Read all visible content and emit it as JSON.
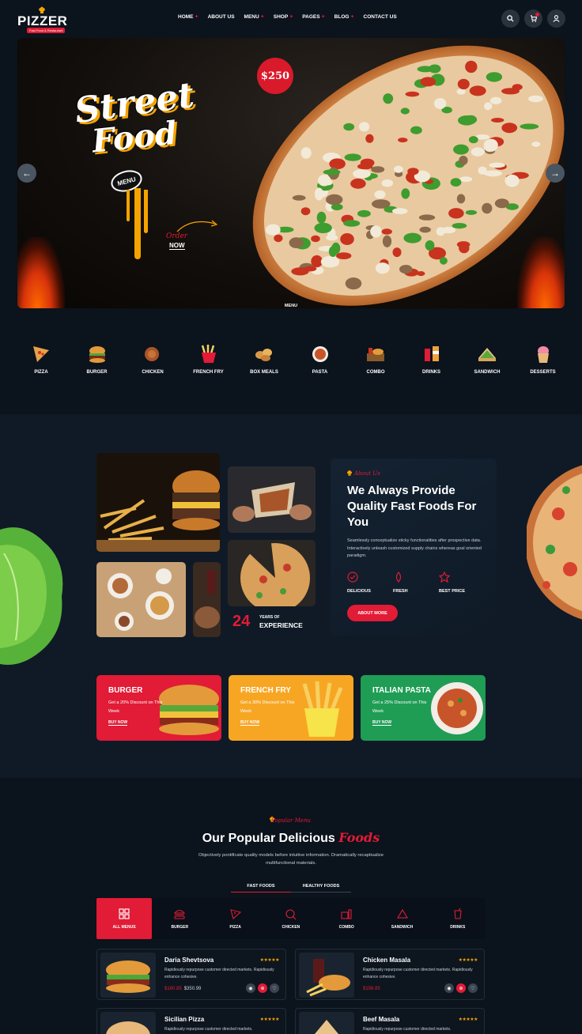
{
  "header": {
    "logo": {
      "text": "PIZZER",
      "tagline": "Fast Food & Restaurant"
    },
    "nav": [
      {
        "label": "HOME",
        "has_dropdown": true
      },
      {
        "label": "ABOUT US",
        "has_dropdown": false
      },
      {
        "label": "MENU",
        "has_dropdown": true
      },
      {
        "label": "SHOP",
        "has_dropdown": true
      },
      {
        "label": "PAGES",
        "has_dropdown": true
      },
      {
        "label": "BLOG",
        "has_dropdown": true
      },
      {
        "label": "CONTACT US",
        "has_dropdown": false
      }
    ],
    "icons": [
      "search-icon",
      "cart-icon",
      "user-icon"
    ]
  },
  "hero": {
    "title_line1": "Street",
    "title_line2": "Food",
    "menu_badge": "MENU",
    "price": "$250",
    "order_script": "Order",
    "order_now": "NOW",
    "caption": "MENU"
  },
  "categories": [
    {
      "label": "PIZZA",
      "icon": "pizza-icon"
    },
    {
      "label": "BURGER",
      "icon": "burger-icon"
    },
    {
      "label": "CHICKEN",
      "icon": "chicken-icon"
    },
    {
      "label": "FRENCH FRY",
      "icon": "fries-icon"
    },
    {
      "label": "BOX MEALS",
      "icon": "box-meal-icon"
    },
    {
      "label": "PASTA",
      "icon": "pasta-icon"
    },
    {
      "label": "COMBO",
      "icon": "combo-icon"
    },
    {
      "label": "DRINKS",
      "icon": "drinks-icon"
    },
    {
      "label": "SANDWICH",
      "icon": "sandwich-icon"
    },
    {
      "label": "DESSERTS",
      "icon": "dessert-icon"
    }
  ],
  "about": {
    "kicker": "About Us",
    "title": "We Always Provide Quality Fast Foods For You",
    "text": "Seamlessly conceptualize sticky functionalities after prospective data. Interactively unleash customized supply chains whereas goal oriented paradigm.",
    "features": [
      {
        "label": "DELICIOUS",
        "icon": "delicious-icon"
      },
      {
        "label": "FRESH",
        "icon": "fresh-icon"
      },
      {
        "label": "BEST PRICE",
        "icon": "best-price-icon"
      }
    ],
    "button": "ABOUT MORE",
    "experience_number": "24",
    "experience_small": "YEARS OF",
    "experience_label": "EXPERIENCE"
  },
  "promos": [
    {
      "title": "BURGER",
      "desc": "Get a 20% Discount on This Week",
      "button": "BUY NOW",
      "color": "#e21b36"
    },
    {
      "title": "FRENCH FRY",
      "desc": "Get a 30% Discount on This Week",
      "button": "BUY NOW",
      "color": "#f7a623"
    },
    {
      "title": "ITALIAN PASTA",
      "desc": "Get a 25% Discount on This Week",
      "button": "BUY NOW",
      "color": "#1f9d55"
    }
  ],
  "menu": {
    "kicker": "Popular Menu",
    "title_main": "Our Popular Delicious ",
    "title_accent": "Foods",
    "subtitle": "Objectively pontificate quality models before intuitive information. Dramatically recaptiualize multifunctional materials.",
    "filter_tabs": [
      {
        "label": "FAST FOODS",
        "active": true
      },
      {
        "label": "HEALTHY FOODS",
        "active": false
      }
    ],
    "tabs": [
      {
        "label": "ALL MENUS",
        "icon": "all-menus-icon",
        "active": true
      },
      {
        "label": "BURGER",
        "icon": "burger-icon",
        "active": false
      },
      {
        "label": "PIZZA",
        "icon": "pizza-icon",
        "active": false
      },
      {
        "label": "CHICKEN",
        "icon": "chicken-icon",
        "active": false
      },
      {
        "label": "COMBO",
        "icon": "combo-icon",
        "active": false
      },
      {
        "label": "SANDWICH",
        "icon": "sandwich-icon",
        "active": false
      },
      {
        "label": "DRINKS",
        "icon": "drinks-icon",
        "active": false
      }
    ],
    "items": [
      {
        "name": "Daria Shevtsova",
        "rating": "★★★★★",
        "desc": "Rapidiously repurpose customer directed markets. Rapidiously enhance cohesive.",
        "price": "$180.85",
        "old_price": "$350.99"
      },
      {
        "name": "Chicken Masala",
        "rating": "★★★★★",
        "desc": "Rapidiously repurpose customer directed markets. Rapidiously enhance cohesive.",
        "price": "$198.85",
        "old_price": ""
      },
      {
        "name": "Sicilian Pizza",
        "rating": "★★★★★",
        "desc": "Rapidiously repurpose customer directed markets.",
        "price": "",
        "old_price": ""
      },
      {
        "name": "Beef Masala",
        "rating": "★★★★★",
        "desc": "Rapidiously repurpose customer directed markets.",
        "price": "",
        "old_price": ""
      }
    ]
  },
  "colors": {
    "accent": "#e21b36",
    "gold": "#f4a300",
    "bg": "#0b131c",
    "panel": "#0f1a26"
  }
}
